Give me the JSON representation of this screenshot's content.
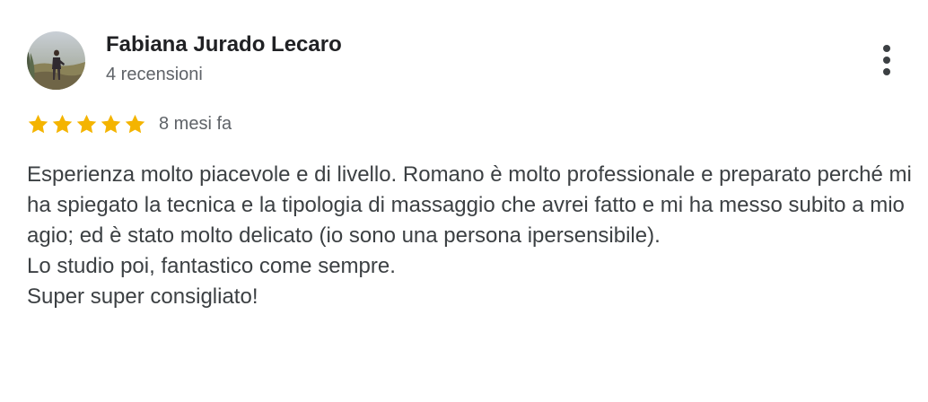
{
  "review": {
    "author": {
      "name": "Fabiana Jurado Lecaro",
      "review_count": "4 recensioni",
      "avatar_icon": "profile-photo"
    },
    "menu": {
      "icon": "more-vert-icon"
    },
    "rating": {
      "stars": 5,
      "max_stars": 5,
      "star_color": "#f4b400",
      "date": "8 mesi fa"
    },
    "text": {
      "paragraphs": [
        "Esperienza molto piacevole e di livello. Romano è molto professionale e preparato perché mi ha spiegato la tecnica e la tipologia di massaggio che avrei fatto e mi ha messo subito a mio agio; ed è stato molto delicato (io sono una persona ipersensibile).",
        "Lo studio poi, fantastico come sempre.",
        "Super super consigliato!"
      ]
    }
  }
}
